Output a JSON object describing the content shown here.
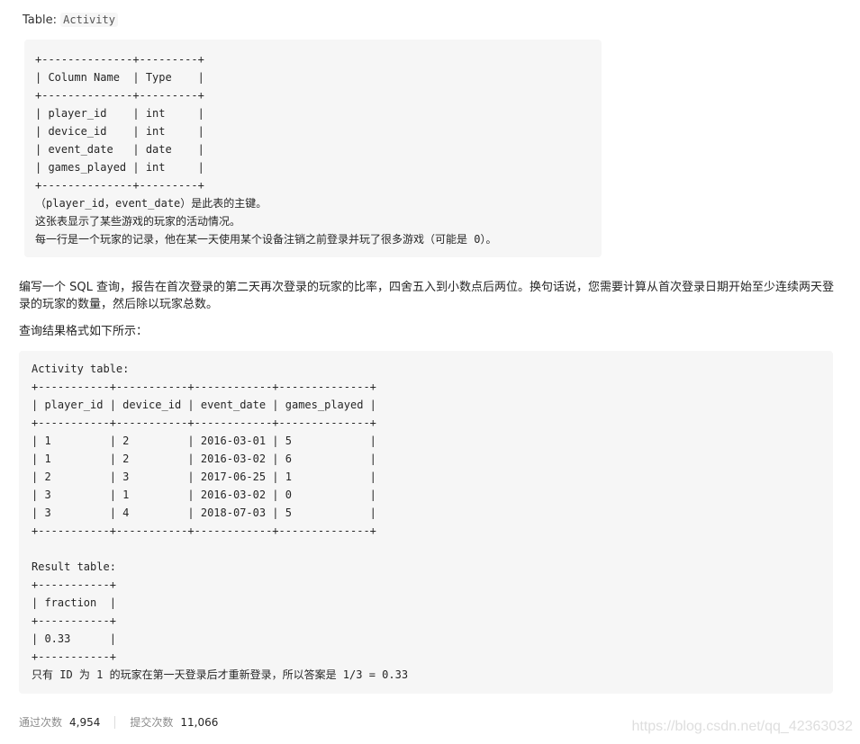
{
  "caption": {
    "label": "Table: ",
    "table_name": "Activity"
  },
  "schema_block": {
    "text": "+--------------+---------+\n| Column Name  | Type    |\n+--------------+---------+\n| player_id    | int     |\n| device_id    | int     |\n| event_date   | date    |\n| games_played | int     |\n+--------------+---------+\n（player_id，event_date）是此表的主键。\n这张表显示了某些游戏的玩家的活动情况。\n每一行是一个玩家的记录，他在某一天使用某个设备注销之前登录并玩了很多游戏（可能是 0）。"
  },
  "question": {
    "text": "编写一个 SQL 查询，报告在首次登录的第二天再次登录的玩家的比率，四舍五入到小数点后两位。换句话说，您需要计算从首次登录日期开始至少连续两天登录的玩家的数量，然后除以玩家总数。"
  },
  "format_note": {
    "text": "查询结果格式如下所示："
  },
  "example_block": {
    "text": "Activity table:\n+-----------+-----------+------------+--------------+\n| player_id | device_id | event_date | games_played |\n+-----------+-----------+------------+--------------+\n| 1         | 2         | 2016-03-01 | 5            |\n| 1         | 2         | 2016-03-02 | 6            |\n| 2         | 3         | 2017-06-25 | 1            |\n| 3         | 1         | 2016-03-02 | 0            |\n| 3         | 4         | 2018-07-03 | 5            |\n+-----------+-----------+------------+--------------+\n\nResult table:\n+-----------+\n| fraction  |\n+-----------+\n| 0.33      |\n+-----------+\n只有 ID 为 1 的玩家在第一天登录后才重新登录，所以答案是 1/3 = 0.33"
  },
  "stats": {
    "accepted_label": "通过次数",
    "accepted_value": "4,954",
    "submissions_label": "提交次数",
    "submissions_value": "11,066"
  },
  "watermark": {
    "text": "https://blog.csdn.net/qq_42363032"
  }
}
